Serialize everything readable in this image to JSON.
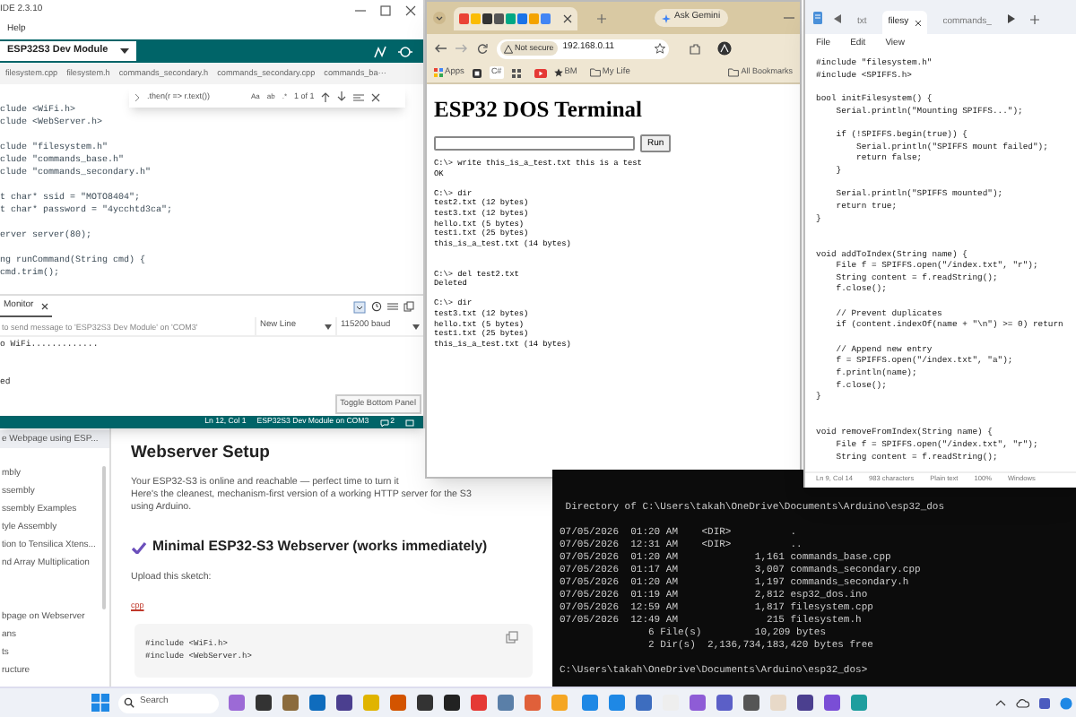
{
  "webpage": {
    "sidebar": [
      {
        "label": "e Webpage using ESP...",
        "selected": true
      },
      {
        "label": "mbly",
        "selected": false
      },
      {
        "label": "ssembly",
        "selected": false
      },
      {
        "label": "ssembly Examples",
        "selected": false
      },
      {
        "label": "tyle Assembly",
        "selected": false
      },
      {
        "label": "tion to Tensilica Xtens...",
        "selected": false
      },
      {
        "label": "nd Array Multiplication",
        "selected": false
      },
      {
        "label": "bpage on Webserver",
        "selected": false
      },
      {
        "label": "ans",
        "selected": false
      },
      {
        "label": "ts",
        "selected": false
      },
      {
        "label": "ructure",
        "selected": false
      }
    ],
    "heading": "Webserver Setup",
    "paragraph": [
      "Your ESP32-S3 is online and reachable — perfect time to turn it",
      "Here's the cleanest, mechanism-first version of a working HTTP server for the S3",
      "using Arduino."
    ],
    "subheading": "Minimal ESP32-S3 Webserver (works immediately)",
    "upload": "Upload this sketch:",
    "lang": "cpp",
    "code": [
      "#include <WiFi.h>",
      "#include <WebServer.h>"
    ]
  },
  "ide": {
    "title": "IDE 2.3.10",
    "menu": [
      "Help"
    ],
    "board": "ESP32S3 Dev Module",
    "tabs": [
      {
        "label": "filesystem.cpp",
        "selected": false
      },
      {
        "label": "filesystem.h",
        "selected": false
      },
      {
        "label": "commands_secondary.h",
        "selected": false
      },
      {
        "label": "commands_secondary.cpp",
        "selected": false
      },
      {
        "label": "commands_ba···",
        "selected": false
      }
    ],
    "find": {
      "query": ".then(r => r.text())",
      "options": [
        "Aa",
        "ab",
        ".*"
      ],
      "count": "1 of 1"
    },
    "code": [
      {
        "lines": [
          "clude <WiFi.h>",
          "clude <WebServer.h>"
        ],
        "double_gap": false
      },
      {
        "lines": [
          "clude \"filesystem.h\"",
          "clude \"commands_base.h\"",
          "clude \"commands_secondary.h\""
        ],
        "double_gap": false
      },
      {
        "lines": [
          "t char* ssid = \"MOTO8404\";",
          "t char* password = \"4ycchtd3ca\";"
        ],
        "double_gap": false
      },
      {
        "lines": [
          "erver server(80);"
        ],
        "double_gap": false
      },
      {
        "lines": [
          "ng runCommand(String cmd) {",
          "cmd.trim();"
        ],
        "double_gap": false
      }
    ],
    "serial": {
      "tab": "Monitor",
      "placeholder": "to send message to 'ESP32S3 Dev Module' on 'COM3'",
      "line_ending": "New Line",
      "baud": "115200 baud",
      "output": [
        {
          "lines": [
            "o WiFi............."
          ],
          "double_gap": true
        },
        {
          "lines": [
            "ed"
          ],
          "double_gap": false
        }
      ]
    },
    "tooltip": "Toggle Bottom Panel",
    "status": {
      "position": "Ln 12, Col 1",
      "board": "ESP32S3 Dev Module on COM3",
      "notifications": "2"
    }
  },
  "browser": {
    "gemini": "Ask Gemini",
    "security": "Not secure",
    "url": "192.168.0.11",
    "bookmarks": [
      "Apps",
      "C#",
      "BM",
      "My Life",
      "All Bookmarks"
    ],
    "page": {
      "title": "ESP32 DOS Terminal",
      "button": "Run",
      "output": [
        {
          "lines": [
            "C:\\> write this_is_a_test.txt this is a test",
            "OK"
          ],
          "double_gap": false
        },
        {
          "lines": [
            "C:\\> dir",
            "test2.txt (12 bytes)",
            "test3.txt (12 bytes)",
            "hello.txt (5 bytes)",
            "test1.txt (25 bytes)",
            "this_is_a_test.txt (14 bytes)"
          ],
          "double_gap": true
        },
        {
          "lines": [
            "C:\\> del test2.txt",
            "Deleted"
          ],
          "double_gap": false
        },
        {
          "lines": [
            "C:\\> dir",
            "test3.txt (12 bytes)",
            "hello.txt (5 bytes)",
            "test1.txt (25 bytes)",
            "this_is_a_test.txt (14 bytes)"
          ],
          "double_gap": false
        }
      ]
    }
  },
  "terminal": {
    "output": [
      {
        "lines": [
          " Directory of C:\\Users\\takah\\OneDrive\\Documents\\Arduino\\esp32_dos"
        ],
        "double_gap": false
      },
      {
        "lines": [
          "07/05/2026  01:20 AM    <DIR>          .",
          "07/05/2026  12:31 AM    <DIR>          ..",
          "07/05/2026  01:20 AM             1,161 commands_base.cpp",
          "07/05/2026  01:17 AM             3,007 commands_secondary.cpp",
          "07/05/2026  01:20 AM             1,197 commands_secondary.h",
          "07/05/2026  01:19 AM             2,812 esp32_dos.ino",
          "07/05/2026  12:59 AM             1,817 filesystem.cpp",
          "07/05/2026  12:49 AM               215 filesystem.h",
          "               6 File(s)         10,209 bytes",
          "               2 Dir(s)  2,136,734,183,420 bytes free"
        ],
        "double_gap": false
      },
      {
        "lines": [
          "C:\\Users\\takah\\OneDrive\\Documents\\Arduino\\esp32_dos>"
        ],
        "double_gap": false
      }
    ]
  },
  "notepad": {
    "tabs": [
      {
        "label": "txt",
        "selected": false
      },
      {
        "label": "filesy",
        "selected": true
      },
      {
        "label": "commands_",
        "selected": false
      }
    ],
    "menu": [
      "File",
      "Edit",
      "View"
    ],
    "code": [
      {
        "lines": [
          "#include \"filesystem.h\"",
          "#include <SPIFFS.h>"
        ],
        "double_gap": false
      },
      {
        "lines": [
          "bool initFilesystem() {",
          "    Serial.println(\"Mounting SPIFFS...\");"
        ],
        "double_gap": false
      },
      {
        "lines": [
          "    if (!SPIFFS.begin(true)) {",
          "        Serial.println(\"SPIFFS mount failed\");",
          "        return false;",
          "    }"
        ],
        "double_gap": false
      },
      {
        "lines": [
          "    Serial.println(\"SPIFFS mounted\");",
          "    return true;",
          "}"
        ],
        "double_gap": true
      },
      {
        "lines": [
          "void addToIndex(String name) {",
          "    File f = SPIFFS.open(\"/index.txt\", \"r\");",
          "    String content = f.readString();",
          "    f.close();"
        ],
        "double_gap": false
      },
      {
        "lines": [
          "    // Prevent duplicates",
          "    if (content.indexOf(name + \"\\n\") >= 0) return"
        ],
        "double_gap": false
      },
      {
        "lines": [
          "    // Append new entry",
          "    f = SPIFFS.open(\"/index.txt\", \"a\");",
          "    f.println(name);",
          "    f.close();",
          "}"
        ],
        "double_gap": true
      },
      {
        "lines": [
          "void removeFromIndex(String name) {",
          "    File f = SPIFFS.open(\"/index.txt\", \"r\");",
          "    String content = f.readString();"
        ],
        "double_gap": false
      }
    ],
    "status": [
      "Ln 9, Col 14",
      "983 characters",
      "Plain text",
      "100%",
      "Windows"
    ]
  },
  "taskbar": {
    "search": "Search"
  }
}
